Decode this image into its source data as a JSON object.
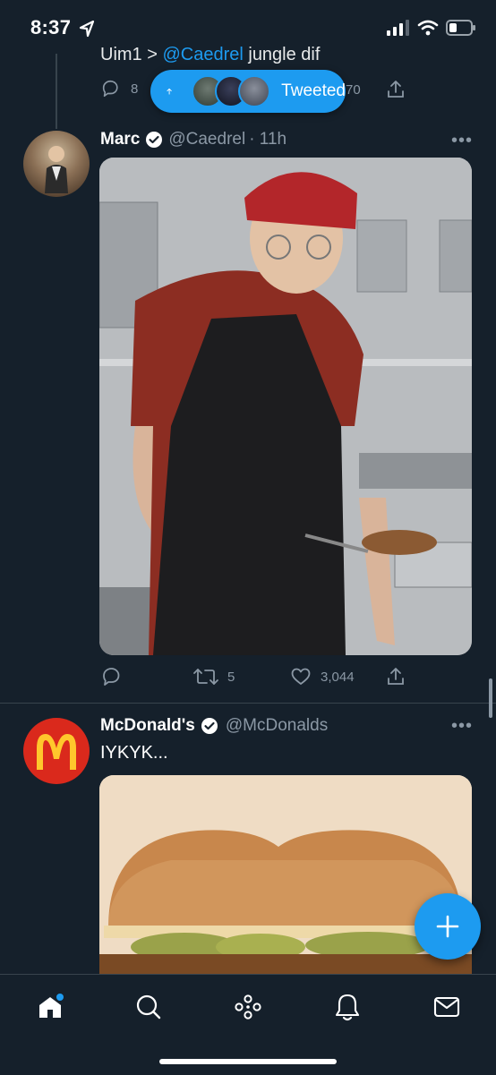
{
  "status_bar": {
    "time": "8:37"
  },
  "prev_tweet": {
    "text_prefix": "Uim1 > ",
    "mention": "@Caedrel",
    "text_suffix": " jungle dif",
    "reply_count": "8",
    "like_count": "70"
  },
  "tweeted_pill": {
    "label": "Tweeted"
  },
  "tweet1": {
    "name": "Marc",
    "handle": "@Caedrel",
    "time": "· 11h",
    "more": "•••",
    "retweets": "5",
    "likes": "3,044"
  },
  "tweet2": {
    "name": "McDonald's",
    "handle": "@McDonalds",
    "more": "•••",
    "text": "IYKYK..."
  },
  "colors": {
    "background": "#15202b",
    "accent": "#1d9bf0",
    "secondary_text": "#8b98a5",
    "mcdonalds_red": "#da291c",
    "mcdonalds_gold": "#ffc72c"
  }
}
